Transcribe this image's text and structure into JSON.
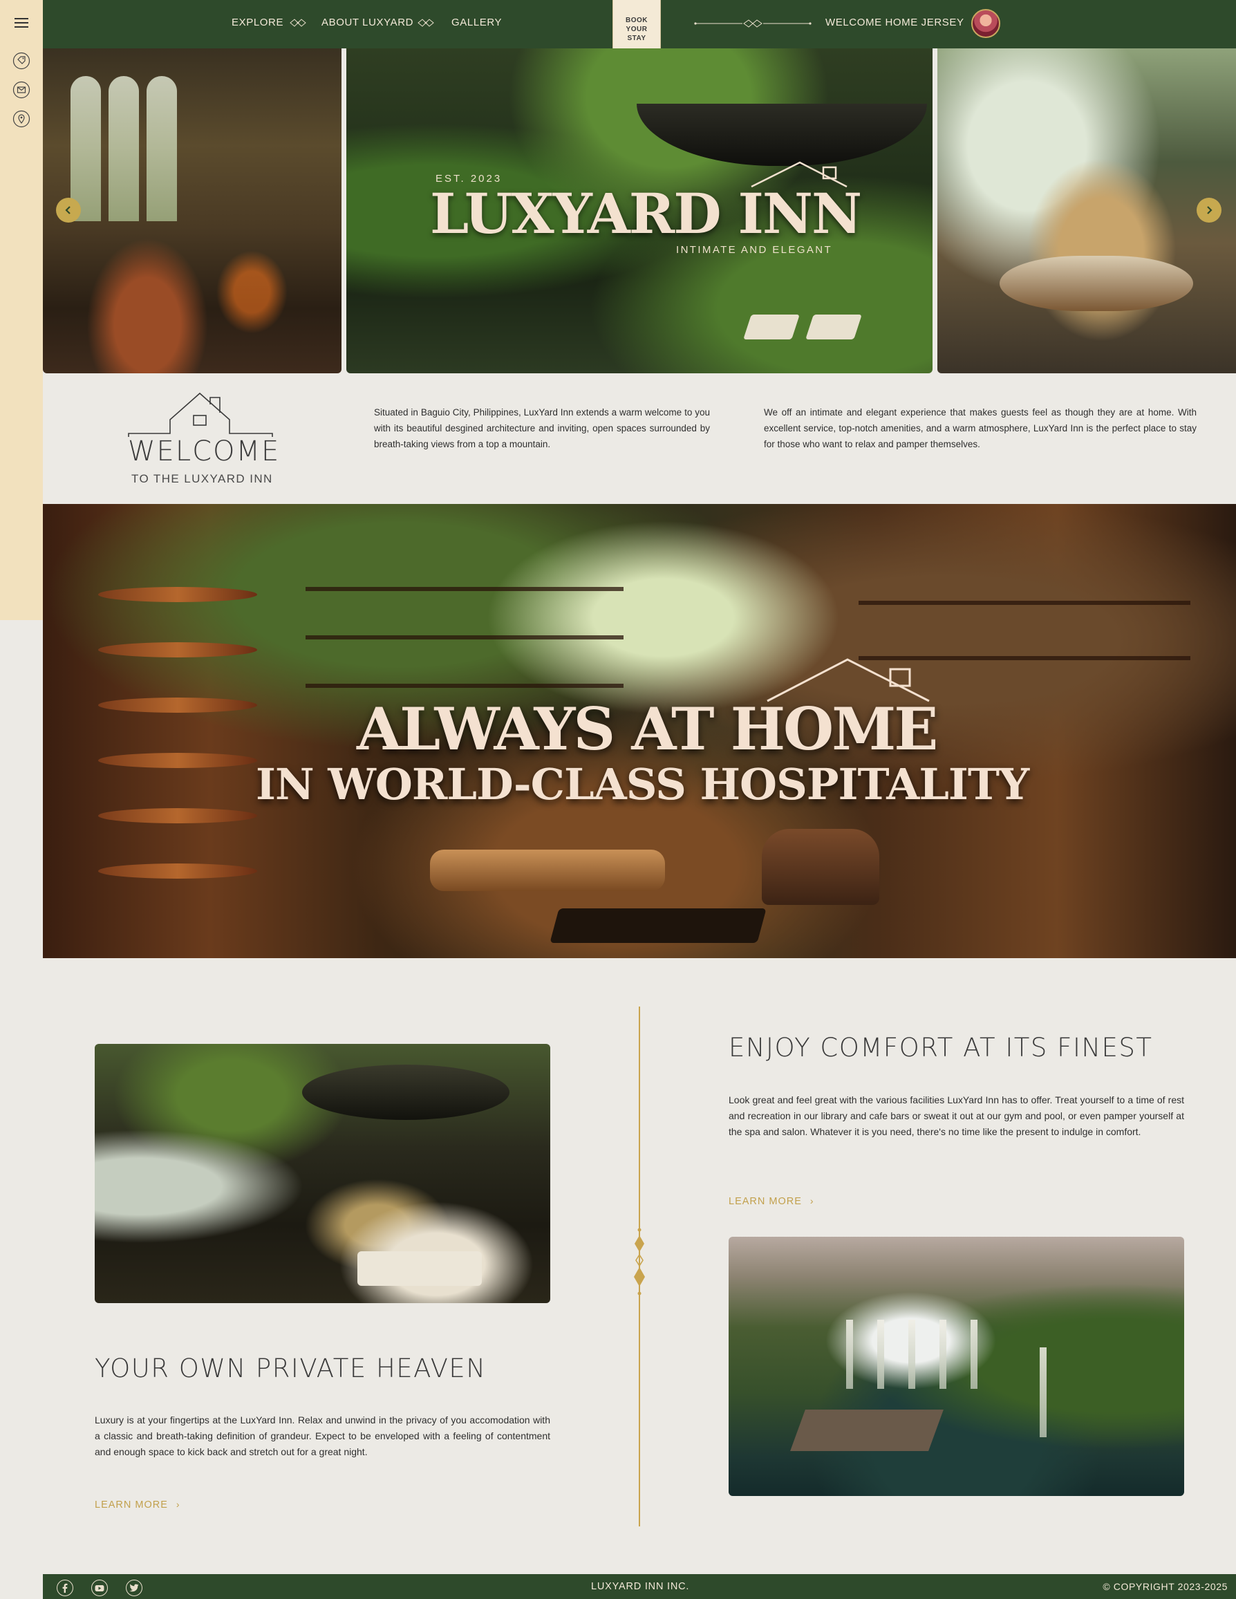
{
  "nav": {
    "items": [
      {
        "label": "EXPLORE"
      },
      {
        "label": "ABOUT LUXYARD"
      },
      {
        "label": "GALLERY"
      }
    ],
    "book": {
      "line1": "BOOK",
      "line2": "YOUR",
      "line3": "STAY"
    },
    "welcome_user": "WELCOME HOME JERSEY"
  },
  "sidebar": {
    "icons": [
      "menu-icon",
      "tag-icon",
      "mail-icon",
      "location-pin-icon"
    ]
  },
  "hero": {
    "est": "EST. 2023",
    "title": "LUXYARD INN",
    "subtitle": "INTIMATE AND ELEGANT"
  },
  "welcome": {
    "word": "WELCOME",
    "sub": "TO THE LUXYARD INN",
    "intro1": "Situated in Baguio City, Philippines, LuxYard Inn extends a warm welcome to you with its beautiful desgined architecture and inviting, open spaces surrounded by breath-taking views from a top a mountain.",
    "intro2": "We off an intimate and elegant experience that makes guests feel as though they are at home. With excellent service, top-notch amenities, and a warm atmosphere, LuxYard Inn is the perfect place to stay for those who want to relax and pamper themselves."
  },
  "banner": {
    "line1": "ALWAYS AT HOME",
    "line2": "IN WORLD-CLASS HOSPITALITY"
  },
  "features": {
    "comfort": {
      "title": "ENJOY COMFORT AT ITS FINEST",
      "text": "Look great and feel great with the various facilities LuxYard Inn has to offer. Treat yourself to a time of rest and recreation in our library and cafe bars or sweat it out at our gym and pool, or even pamper yourself at the spa and salon. Whatever it is you need, there's no time like the present to indulge in comfort.",
      "cta": "LEARN MORE"
    },
    "private": {
      "title": "YOUR OWN PRIVATE HEAVEN",
      "text": "Luxury is at your fingertips at the LuxYard Inn. Relax and unwind in the privacy of you accomodation with a classic and breath-taking definition of grandeur. Expect to be enveloped with a feeling of contentment and enough space to kick back and stretch out for a great night.",
      "cta": "LEARN MORE"
    }
  },
  "footer": {
    "company": "LUXYARD INN INC.",
    "copyright": "© COPYRIGHT 2023-2025",
    "social": [
      "facebook-icon",
      "youtube-icon",
      "twitter-icon"
    ]
  },
  "colors": {
    "forest_green": "#2e4a2b",
    "cream_sidebar": "#f2e1be",
    "gold_accent": "#c2a04c",
    "page_bg": "#eceae5"
  }
}
